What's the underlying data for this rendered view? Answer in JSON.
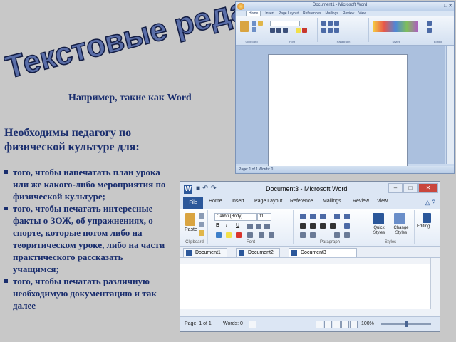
{
  "slide": {
    "title": "Текстовые редакторы",
    "subtitle": "Например, такие как Word",
    "heading": "Необходимы педагогу по физической культуре для:",
    "bullets": [
      "того, чтобы напечатать план урока или же какого-либо мероприятия по физической культуре;",
      "того, чтобы печатать интересные факты о ЗОЖ, об упражнениях, о спорте, которые потом либо на теоритическом уроке, либо на части практического рассказать учащимся;",
      "того, чтобы печатать различную необходимую документацию и так далее"
    ],
    "colors": {
      "text": "#1a2e6e",
      "background": "#c8c8c8",
      "title_fill": "#5a6ea8",
      "title_outline": "#141e44"
    }
  },
  "word2007": {
    "title": "Document1 - Microsoft Word",
    "tabs": [
      "Home",
      "Insert",
      "Page Layout",
      "References",
      "Mailings",
      "Review",
      "View"
    ],
    "groups": [
      "Clipboard",
      "Font",
      "Paragraph",
      "Styles",
      "Editing"
    ],
    "status": "Page: 1 of 1   Words: 0"
  },
  "word2010": {
    "title": "Document3 - Microsoft Word",
    "qat_icons": [
      "save-icon",
      "undo-icon",
      "redo-icon"
    ],
    "window_buttons": {
      "minimize": "–",
      "maximize": "□",
      "close": "✕"
    },
    "tabs": {
      "file": "File",
      "home": "Home",
      "insert": "Insert",
      "page_layout": "Page Layout",
      "references": "Reference",
      "mailings": "Mailings",
      "review": "Review",
      "view": "View"
    },
    "ribbon": {
      "paste_label": "Paste",
      "font_name": "Calibri (Body)",
      "font_size": "11",
      "bold": "B",
      "italic": "I",
      "underline": "U",
      "style1": "Quick Styles",
      "style2": "Change Styles",
      "editing": "Editing",
      "group_clipboard": "Clipboard",
      "group_font": "Font",
      "group_paragraph": "Paragraph",
      "group_styles": "Styles"
    },
    "doc_tabs": [
      "Document1",
      "Document2",
      "Document3"
    ],
    "status": {
      "page": "Page: 1 of 1",
      "words": "Words: 0",
      "zoom": "100%"
    }
  }
}
